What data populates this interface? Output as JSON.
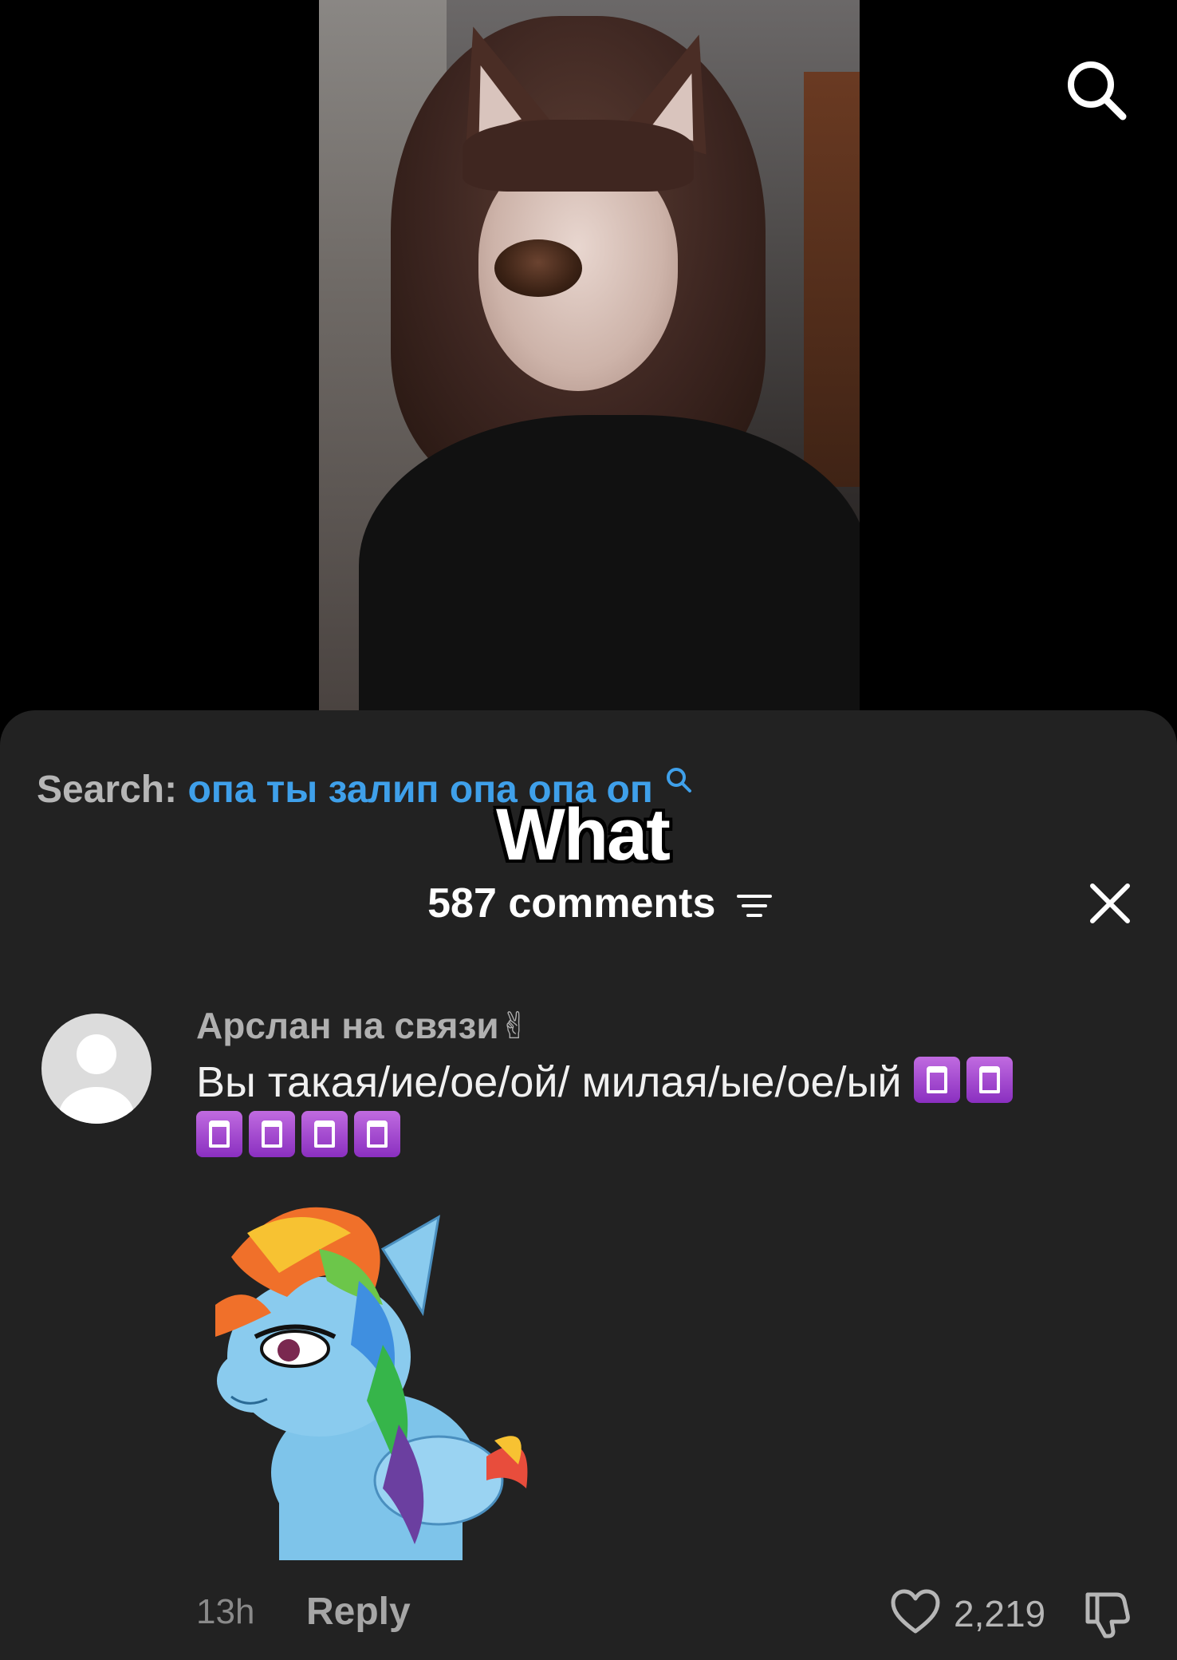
{
  "video": {
    "search_icon": "search-icon"
  },
  "sheet": {
    "search_label": "Search:",
    "search_query": "опа ты залип опа опа оп",
    "overlay_text": "What",
    "comments_count": "587 comments",
    "sort_icon": "sort-icon",
    "close_icon": "close-icon"
  },
  "comment": {
    "author": "Арслан на связи✌",
    "text": "Вы такая/ие/ое/ой/ милая/ые/ое/ый",
    "emoji_count_inline": 2,
    "emoji_count_second_line": 4,
    "emoji_name": "purple-elevator-emoji",
    "sticker": "pony-sticker",
    "time": "13h",
    "reply_label": "Reply",
    "like_count": "2,219"
  },
  "colors": {
    "sheet_bg": "#222222",
    "query_blue": "#3fa0ea",
    "muted_text": "#b0b0b0"
  }
}
